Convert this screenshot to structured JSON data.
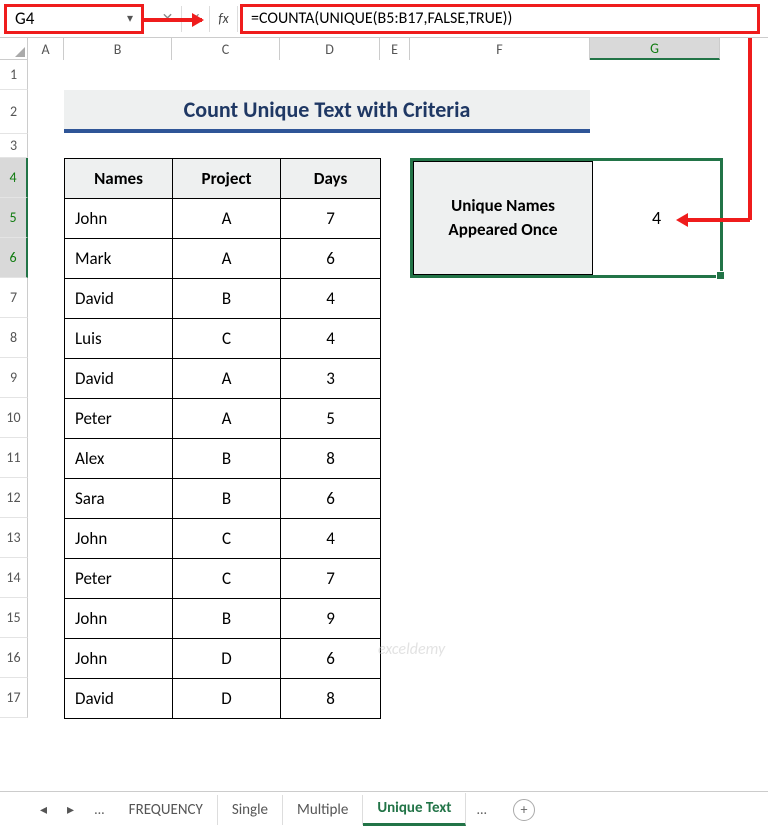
{
  "nameBox": {
    "value": "G4"
  },
  "formulaBar": {
    "formula": "=COUNTA(UNIQUE(B5:B17,FALSE,TRUE))"
  },
  "columns": [
    "A",
    "B",
    "C",
    "D",
    "E",
    "F",
    "G"
  ],
  "rows": [
    "1",
    "2",
    "3",
    "4",
    "5",
    "6",
    "7",
    "8",
    "9",
    "10",
    "11",
    "12",
    "13",
    "14",
    "15",
    "16",
    "17"
  ],
  "title": "Count Unique Text with Criteria",
  "table": {
    "headers": [
      "Names",
      "Project",
      "Days"
    ],
    "rows": [
      {
        "name": "John",
        "project": "A",
        "days": "7"
      },
      {
        "name": "Mark",
        "project": "A",
        "days": "6"
      },
      {
        "name": "David",
        "project": "B",
        "days": "4"
      },
      {
        "name": "Luis",
        "project": "C",
        "days": "4"
      },
      {
        "name": "David",
        "project": "A",
        "days": "3"
      },
      {
        "name": "Peter",
        "project": "A",
        "days": "5"
      },
      {
        "name": "Alex",
        "project": "B",
        "days": "8"
      },
      {
        "name": "Sara",
        "project": "B",
        "days": "6"
      },
      {
        "name": "John",
        "project": "C",
        "days": "4"
      },
      {
        "name": "Peter",
        "project": "C",
        "days": "7"
      },
      {
        "name": "John",
        "project": "B",
        "days": "9"
      },
      {
        "name": "John",
        "project": "D",
        "days": "6"
      },
      {
        "name": "David",
        "project": "D",
        "days": "8"
      }
    ]
  },
  "result": {
    "label": "Unique Names Appeared Once",
    "value": "4"
  },
  "tabs": {
    "items": [
      "FREQUENCY",
      "Single",
      "Multiple",
      "Unique Text"
    ],
    "activeIndex": 3,
    "ellipsis": "..."
  },
  "watermark": "exceldemy",
  "icons": {
    "chevronDown": "▾",
    "fx": "fx",
    "navLeft": "◂",
    "navRight": "▸",
    "plus": "+"
  }
}
